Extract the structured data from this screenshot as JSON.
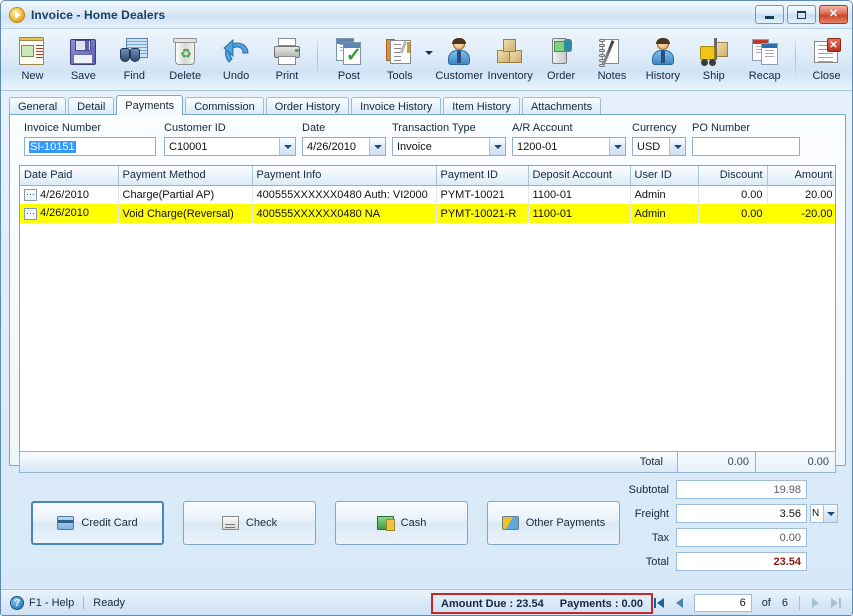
{
  "window": {
    "title": "Invoice - Home Dealers",
    "icon": "play-circle-icon",
    "controls": {
      "minimize": "minimize-button",
      "maximize": "maximize-button",
      "close": "close-button",
      "close_glyph": "✕"
    }
  },
  "toolbar": {
    "items": [
      {
        "label": "New",
        "icon": "new-document-icon"
      },
      {
        "label": "Save",
        "icon": "floppy-disk-icon"
      },
      {
        "label": "Find",
        "icon": "binoculars-icon"
      },
      {
        "label": "Delete",
        "icon": "recycle-bin-icon"
      },
      {
        "label": "Undo",
        "icon": "undo-arrow-icon"
      },
      {
        "label": "Print",
        "icon": "printer-icon"
      },
      {
        "label": "Post",
        "icon": "post-checkmark-icon"
      },
      {
        "label": "Tools",
        "icon": "tools-wrench-icon"
      },
      {
        "label": "Customer",
        "icon": "customer-person-icon"
      },
      {
        "label": "Inventory",
        "icon": "inventory-boxes-icon"
      },
      {
        "label": "Order",
        "icon": "order-device-icon"
      },
      {
        "label": "Notes",
        "icon": "notes-pen-icon"
      },
      {
        "label": "History",
        "icon": "history-person-icon"
      },
      {
        "label": "Ship",
        "icon": "forklift-icon"
      },
      {
        "label": "Recap",
        "icon": "recap-documents-icon"
      },
      {
        "label": "Close",
        "icon": "close-document-icon"
      }
    ]
  },
  "tabs": [
    {
      "label": "General",
      "active": false
    },
    {
      "label": "Detail",
      "active": false
    },
    {
      "label": "Payments",
      "active": true
    },
    {
      "label": "Commission",
      "active": false
    },
    {
      "label": "Order History",
      "active": false
    },
    {
      "label": "Invoice History",
      "active": false
    },
    {
      "label": "Item History",
      "active": false
    },
    {
      "label": "Attachments",
      "active": false
    }
  ],
  "form": {
    "invoice_number": {
      "label": "Invoice Number",
      "value": "SI-10151"
    },
    "customer_id": {
      "label": "Customer ID",
      "value": "C10001"
    },
    "date": {
      "label": "Date",
      "value": "4/26/2010"
    },
    "transaction_type": {
      "label": "Transaction Type",
      "value": "Invoice"
    },
    "ar_account": {
      "label": "A/R Account",
      "value": "1200-01"
    },
    "currency": {
      "label": "Currency",
      "value": "USD"
    },
    "po_number": {
      "label": "PO Number",
      "value": ""
    }
  },
  "grid": {
    "columns": [
      "Date Paid",
      "Payment Method",
      "Payment Info",
      "Payment ID",
      "Deposit Account",
      "User ID",
      "Discount",
      "Amount"
    ],
    "rows": [
      {
        "date_paid": "4/26/2010",
        "payment_method": "Charge(Partial AP)",
        "payment_info": "400555XXXXXX0480 Auth: VI2000",
        "payment_id": "PYMT-10021",
        "deposit_account": "1100-01",
        "user_id": "Admin",
        "discount": "0.00",
        "amount": "20.00",
        "highlighted": false
      },
      {
        "date_paid": "4/26/2010",
        "payment_method": "Void Charge(Reversal)",
        "payment_info": "400555XXXXXX0480 NA",
        "payment_id": "PYMT-10021-R",
        "deposit_account": "1100-01",
        "user_id": "Admin",
        "discount": "0.00",
        "amount": "-20.00",
        "highlighted": true
      }
    ],
    "total": {
      "label": "Total",
      "discount": "0.00",
      "amount": "0.00"
    }
  },
  "payment_buttons": [
    {
      "label": "Credit Card",
      "icon": "credit-card-icon"
    },
    {
      "label": "Check",
      "icon": "check-icon"
    },
    {
      "label": "Cash",
      "icon": "cash-icon"
    },
    {
      "label": "Other Payments",
      "icon": "other-payments-icon"
    }
  ],
  "totals": {
    "subtotal": {
      "label": "Subtotal",
      "value": "19.98"
    },
    "freight": {
      "label": "Freight",
      "value": "3.56",
      "method": "N"
    },
    "tax": {
      "label": "Tax",
      "value": "0.00"
    },
    "total": {
      "label": "Total",
      "value": "23.54"
    }
  },
  "statusbar": {
    "help": "F1 - Help",
    "status": "Ready",
    "amount_due": "Amount Due : 23.54",
    "payments": "Payments : 0.00",
    "page_current": "6",
    "of_label": "of",
    "page_total": "6"
  },
  "colors": {
    "highlight_row": "#ffff00",
    "total_accent": "#8b1a1a",
    "alert_border": "#c62828",
    "selection": "#3399ff"
  }
}
